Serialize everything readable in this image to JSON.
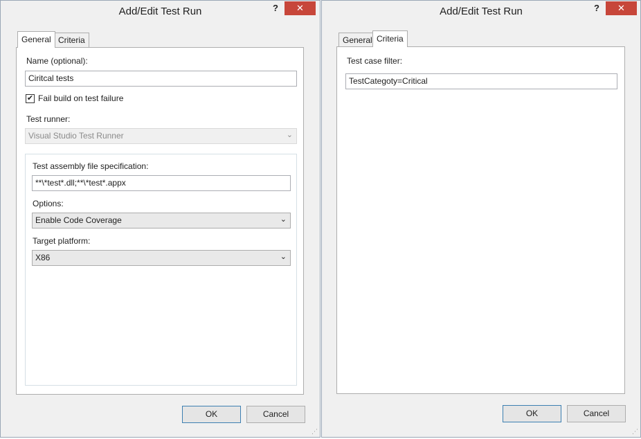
{
  "dialog_left": {
    "title": "Add/Edit Test Run",
    "help_label": "?",
    "close_label": "✕",
    "tabs": [
      {
        "label": "General"
      },
      {
        "label": "Criteria"
      }
    ],
    "name_label": "Name (optional):",
    "name_value": "Ciritcal tests",
    "fail_build_label": "Fail build on test failure",
    "fail_build_checked": "✔",
    "test_runner_label": "Test runner:",
    "test_runner_value": "Visual Studio Test Runner",
    "assembly_label": "Test assembly file specification:",
    "assembly_value": "**\\*test*.dll;**\\*test*.appx",
    "options_label": "Options:",
    "options_value": "Enable Code Coverage",
    "platform_label": "Target platform:",
    "platform_value": "X86",
    "ok_label": "OK",
    "cancel_label": "Cancel"
  },
  "dialog_right": {
    "title": "Add/Edit Test Run",
    "help_label": "?",
    "close_label": "✕",
    "tabs": [
      {
        "label": "General"
      },
      {
        "label": "Criteria"
      }
    ],
    "filter_label": "Test case filter:",
    "filter_value": "TestCategoty=Critical",
    "ok_label": "OK",
    "cancel_label": "Cancel"
  },
  "icons": {
    "chevron": "⌄",
    "grip": "⋰"
  },
  "colors": {
    "close_red": "#c7463a",
    "default_button_border": "#3c7fb1"
  }
}
